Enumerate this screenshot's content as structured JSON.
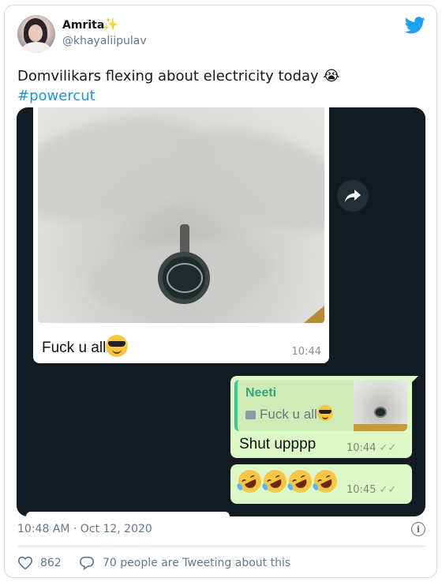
{
  "author": {
    "display_name": "Amrita",
    "handle": "@khayaliipulav"
  },
  "tweet": {
    "text": "Domvilikars flexing about electricity today",
    "emoji": "😭",
    "hashtag": "#powercut"
  },
  "chat": {
    "incoming": {
      "text": "Fuck u all",
      "time": "10:44"
    },
    "reply": {
      "quoted_name": "Neeti",
      "quoted_text": "Fuck u all",
      "text": "Shut upppp",
      "time": "10:44",
      "ticks": "✓✓"
    },
    "reply2": {
      "time": "10:45",
      "ticks": "✓✓"
    }
  },
  "meta": {
    "timestamp": "10:48 AM · Oct 12, 2020",
    "like_count": "862",
    "tweeting_about": "70 people are Tweeting about this"
  },
  "colors": {
    "brand": "#1da1f2",
    "hashtag": "#1b95e0",
    "chat_bg": "#111b21",
    "outgoing_bubble": "#dcf8c6",
    "quote_name": "#35a57a"
  },
  "icons": [
    "twitter-bird-icon",
    "sparkles-icon",
    "forward-arrow-icon",
    "image-icon",
    "info-icon",
    "heart-icon",
    "comment-icon"
  ]
}
